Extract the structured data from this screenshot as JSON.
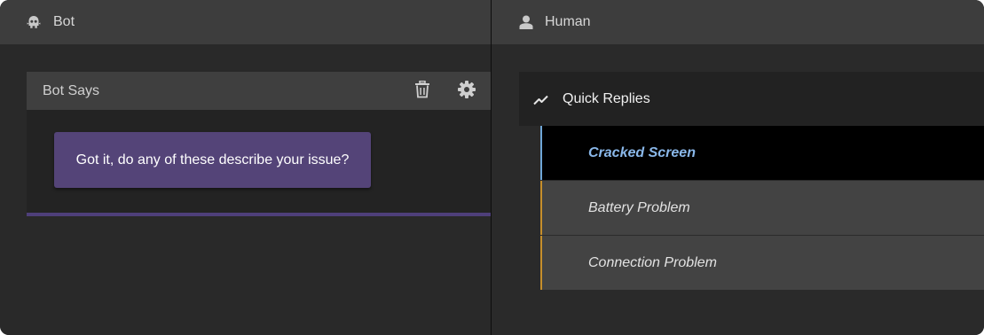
{
  "bot_panel": {
    "title": "Bot",
    "icon": "bot-icon",
    "card": {
      "title": "Bot Says",
      "actions": [
        {
          "name": "delete",
          "icon": "trash-icon"
        },
        {
          "name": "settings",
          "icon": "gear-icon"
        }
      ],
      "message": "Got it, do any of these describe your issue?"
    }
  },
  "human_panel": {
    "title": "Human",
    "icon": "user-icon",
    "quick_replies": {
      "title": "Quick Replies",
      "icon": "quick-replies-icon",
      "items": [
        {
          "label": "Cracked Screen",
          "selected": true
        },
        {
          "label": "Battery Problem",
          "selected": false
        },
        {
          "label": "Connection Problem",
          "selected": false
        }
      ]
    }
  },
  "colors": {
    "bubble": "#544478",
    "selected_accent": "#6fa6d7",
    "item_accent": "#c68e2b",
    "card_underline": "#4e3f7a"
  }
}
